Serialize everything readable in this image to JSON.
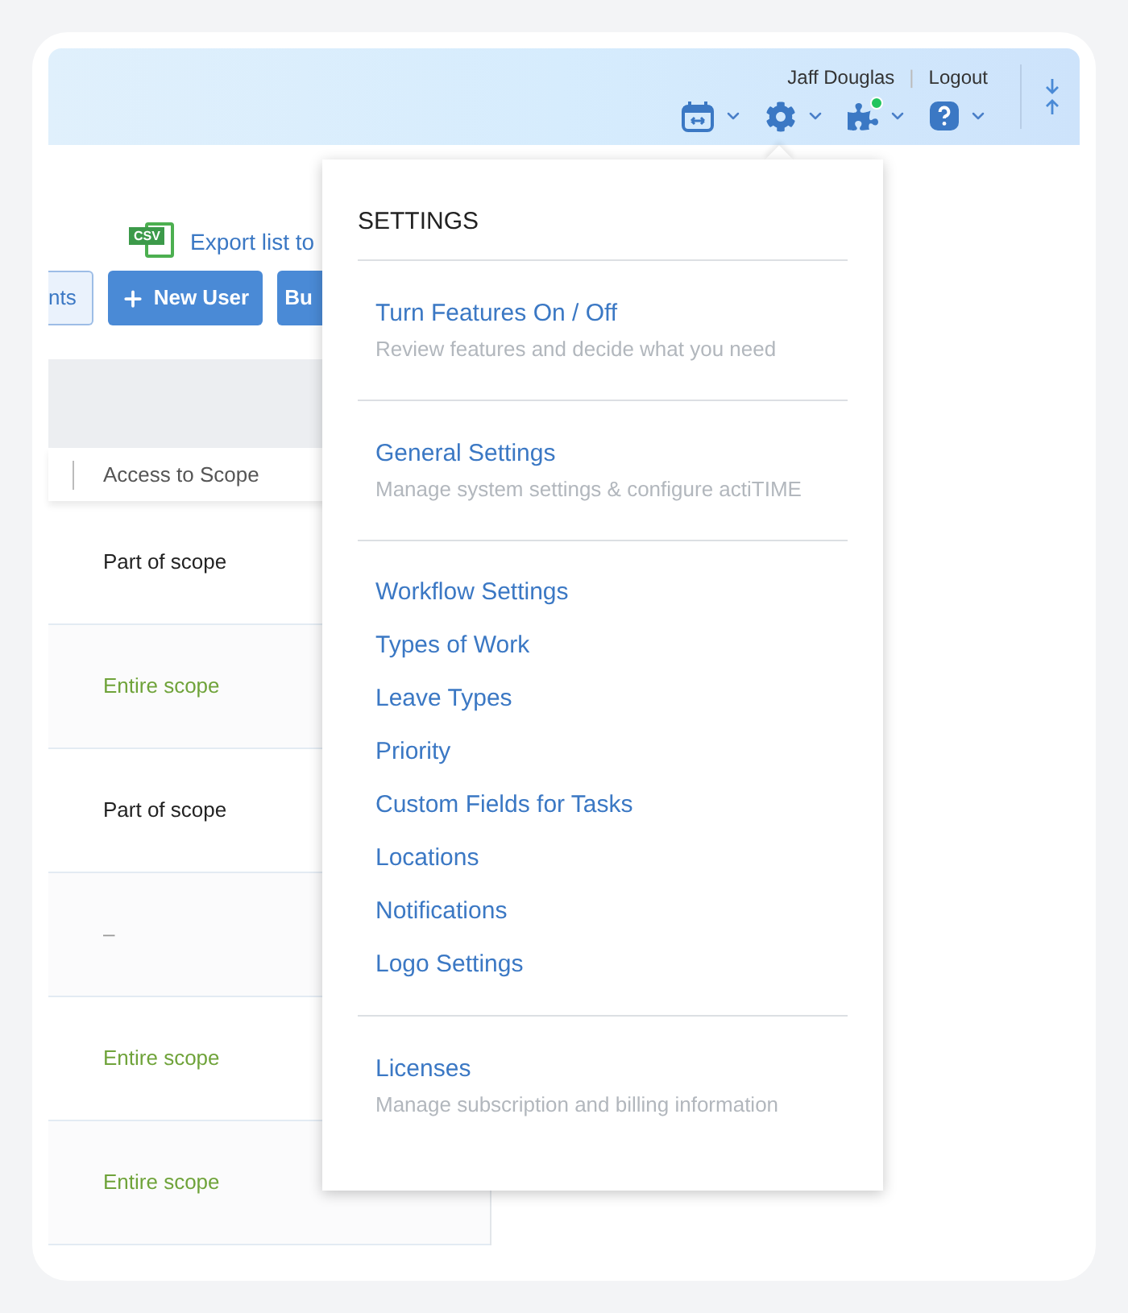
{
  "header": {
    "user": "Jaff Douglas",
    "separator": "|",
    "logout": "Logout",
    "addons_notification": true
  },
  "export": {
    "badge": "CSV",
    "label": "Export list to"
  },
  "buttons": [
    {
      "label": "nts",
      "kind": "outline"
    },
    {
      "label": "New User",
      "kind": "add"
    },
    {
      "label": "Bu",
      "kind": "primary"
    }
  ],
  "table": {
    "columns": [
      "Access to Scope"
    ],
    "rows": [
      {
        "scope": "Part of scope",
        "kind": "partial"
      },
      {
        "scope": "Entire scope",
        "kind": "entire"
      },
      {
        "scope": "Part of scope",
        "kind": "partial"
      },
      {
        "scope": "–",
        "kind": "none"
      },
      {
        "scope": "Entire scope",
        "kind": "entire"
      },
      {
        "scope": "Entire scope",
        "kind": "entire"
      }
    ]
  },
  "settings_menu": {
    "title": "SETTINGS",
    "sections": [
      {
        "items": [
          {
            "label": "Turn Features On / Off",
            "description": "Review features and decide what you need"
          }
        ]
      },
      {
        "items": [
          {
            "label": "General Settings",
            "description": "Manage system settings & configure actiTIME"
          }
        ]
      },
      {
        "items": [
          {
            "label": "Workflow Settings"
          },
          {
            "label": "Types of Work"
          },
          {
            "label": "Leave Types"
          },
          {
            "label": "Priority"
          },
          {
            "label": "Custom Fields for Tasks"
          },
          {
            "label": "Locations"
          },
          {
            "label": "Notifications"
          },
          {
            "label": "Logo Settings"
          }
        ]
      },
      {
        "items": [
          {
            "label": "Licenses",
            "description": "Manage subscription and billing information"
          }
        ]
      }
    ]
  }
}
